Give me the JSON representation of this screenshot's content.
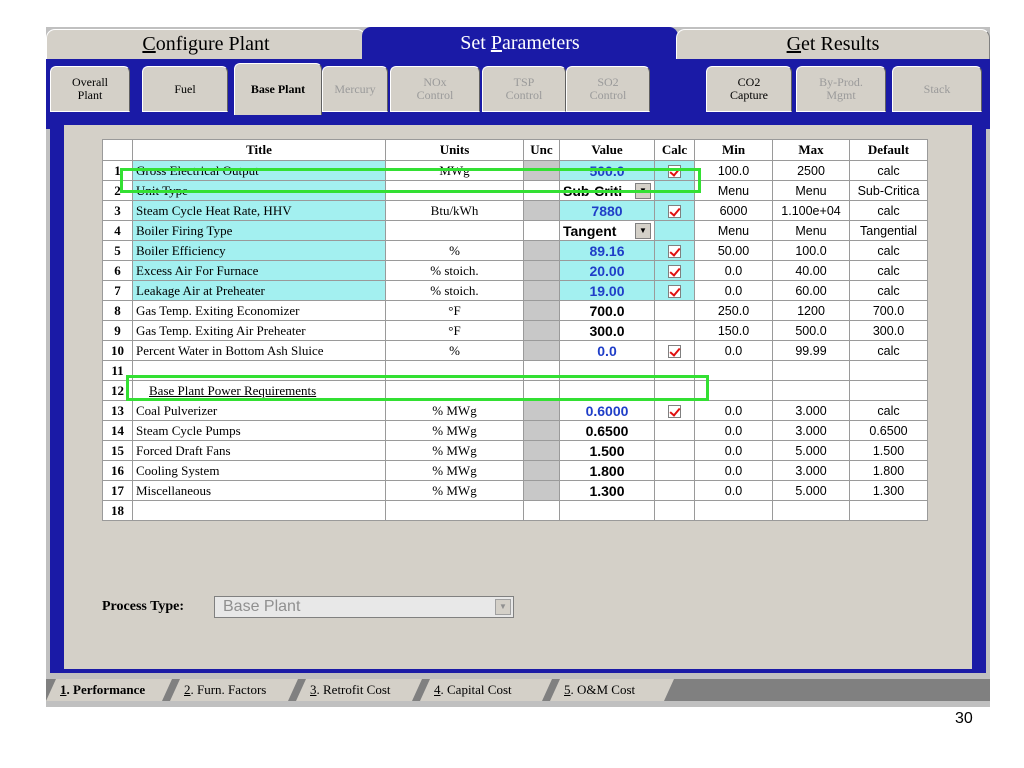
{
  "top_tabs": [
    {
      "pre": "",
      "u": "C",
      "post": "onfigure Plant"
    },
    {
      "pre": "Set ",
      "u": "P",
      "post": "arameters"
    },
    {
      "pre": "",
      "u": "G",
      "post": "et Results"
    }
  ],
  "sub_tabs": [
    {
      "line1": "Overall",
      "line2": "Plant"
    },
    {
      "line1": "Fuel",
      "line2": ""
    },
    {
      "line1": "Base Plant",
      "line2": ""
    },
    {
      "line1": "Mercury",
      "line2": ""
    },
    {
      "line1": "NOx",
      "line2": "Control"
    },
    {
      "line1": "TSP",
      "line2": "Control"
    },
    {
      "line1": "SO2",
      "line2": "Control"
    },
    {
      "line1": "CO2",
      "line2": "Capture"
    },
    {
      "line1": "By-Prod.",
      "line2": "Mgmt"
    },
    {
      "line1": "Stack",
      "line2": ""
    }
  ],
  "table": {
    "headers": [
      "",
      "Title",
      "Units",
      "Unc",
      "Value",
      "Calc",
      "Min",
      "Max",
      "Default"
    ],
    "rows": [
      {
        "n": "1",
        "title": "Gross Electrical Output",
        "units": "MWg",
        "value": "500.0",
        "calc": true,
        "min": "100.0",
        "max": "2500",
        "def": "calc"
      },
      {
        "n": "2",
        "title": "Unit Type",
        "units": "",
        "value": "Sub-Criti",
        "calc": false,
        "min": "Menu",
        "max": "Menu",
        "def": "Sub-Critica"
      },
      {
        "n": "3",
        "title": "Steam Cycle Heat Rate, HHV",
        "units": "Btu/kWh",
        "value": "7880",
        "calc": true,
        "min": "6000",
        "max": "1.100e+04",
        "def": "calc"
      },
      {
        "n": "4",
        "title": "Boiler Firing Type",
        "units": "",
        "value": "Tangent",
        "calc": false,
        "min": "Menu",
        "max": "Menu",
        "def": "Tangential"
      },
      {
        "n": "5",
        "title": "Boiler Efficiency",
        "units": "%",
        "value": "89.16",
        "calc": true,
        "min": "50.00",
        "max": "100.0",
        "def": "calc"
      },
      {
        "n": "6",
        "title": "Excess Air For Furnace",
        "units": "% stoich.",
        "value": "20.00",
        "calc": true,
        "min": "0.0",
        "max": "40.00",
        "def": "calc"
      },
      {
        "n": "7",
        "title": "Leakage Air at Preheater",
        "units": "% stoich.",
        "value": "19.00",
        "calc": true,
        "min": "0.0",
        "max": "60.00",
        "def": "calc"
      },
      {
        "n": "8",
        "title": "Gas Temp. Exiting Economizer",
        "units": "°F",
        "value": "700.0",
        "calc": false,
        "min": "250.0",
        "max": "1200",
        "def": "700.0"
      },
      {
        "n": "9",
        "title": "Gas Temp. Exiting Air Preheater",
        "units": "°F",
        "value": "300.0",
        "calc": false,
        "min": "150.0",
        "max": "500.0",
        "def": "300.0"
      },
      {
        "n": "10",
        "title": "Percent Water in Bottom Ash Sluice",
        "units": "%",
        "value": "0.0",
        "calc": true,
        "min": "0.0",
        "max": "99.99",
        "def": "calc"
      },
      {
        "n": "11",
        "title": "",
        "units": "",
        "value": "",
        "calc": false,
        "min": "",
        "max": "",
        "def": ""
      },
      {
        "n": "12",
        "title": "Base Plant Power Requirements",
        "units": "",
        "value": "",
        "calc": false,
        "min": "",
        "max": "",
        "def": ""
      },
      {
        "n": "13",
        "title": "Coal Pulverizer",
        "units": "% MWg",
        "value": "0.6000",
        "calc": true,
        "min": "0.0",
        "max": "3.000",
        "def": "calc"
      },
      {
        "n": "14",
        "title": "Steam Cycle Pumps",
        "units": "% MWg",
        "value": "0.6500",
        "calc": false,
        "min": "0.0",
        "max": "3.000",
        "def": "0.6500"
      },
      {
        "n": "15",
        "title": "Forced Draft Fans",
        "units": "% MWg",
        "value": "1.500",
        "calc": false,
        "min": "0.0",
        "max": "5.000",
        "def": "1.500"
      },
      {
        "n": "16",
        "title": "Cooling System",
        "units": "% MWg",
        "value": "1.800",
        "calc": false,
        "min": "0.0",
        "max": "3.000",
        "def": "1.800"
      },
      {
        "n": "17",
        "title": "Miscellaneous",
        "units": "% MWg",
        "value": "1.300",
        "calc": false,
        "min": "0.0",
        "max": "5.000",
        "def": "1.300"
      },
      {
        "n": "18",
        "title": "",
        "units": "",
        "value": "",
        "calc": false,
        "min": "",
        "max": "",
        "def": ""
      }
    ]
  },
  "process_type": {
    "label": "Process Type:",
    "value": "Base Plant"
  },
  "bottom_tabs": [
    {
      "u": "1",
      "post": ". Performance"
    },
    {
      "u": "2",
      "post": ". Furn. Factors"
    },
    {
      "u": "3",
      "post": ". Retrofit Cost"
    },
    {
      "u": "4",
      "post": ". Capital Cost"
    },
    {
      "u": "5",
      "post": ". O&M Cost"
    }
  ],
  "slide": {
    "page_number": "30"
  },
  "colors": {
    "accent_blue": "#1a1aa6",
    "cyan_row": "#a3f0f0",
    "highlight_green": "#33e033",
    "value_blue": "#1f3ec8",
    "check_red": "#e01010"
  }
}
